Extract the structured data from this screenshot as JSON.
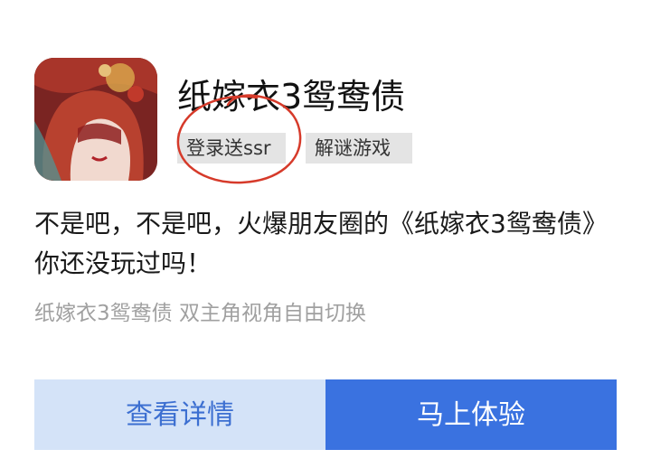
{
  "app": {
    "title": "纸嫁衣3鸳鸯债",
    "icon": "game-cover-icon",
    "tags": [
      "登录送ssr",
      "解谜游戏"
    ]
  },
  "description": "不是吧，不是吧，火爆朋友圈的《纸嫁衣3鸳鸯债》你还没玩过吗！",
  "subtitle": "纸嫁衣3鸳鸯债 双主角视角自由切换",
  "buttons": {
    "detail_label": "查看详情",
    "play_label": "马上体验"
  },
  "colors": {
    "primary": "#3a72e0",
    "secondary_bg": "#d4e3f8",
    "secondary_text": "#3c6fd1",
    "tag_bg": "#e4e4e4",
    "annotation_circle": "#d63a2a"
  }
}
